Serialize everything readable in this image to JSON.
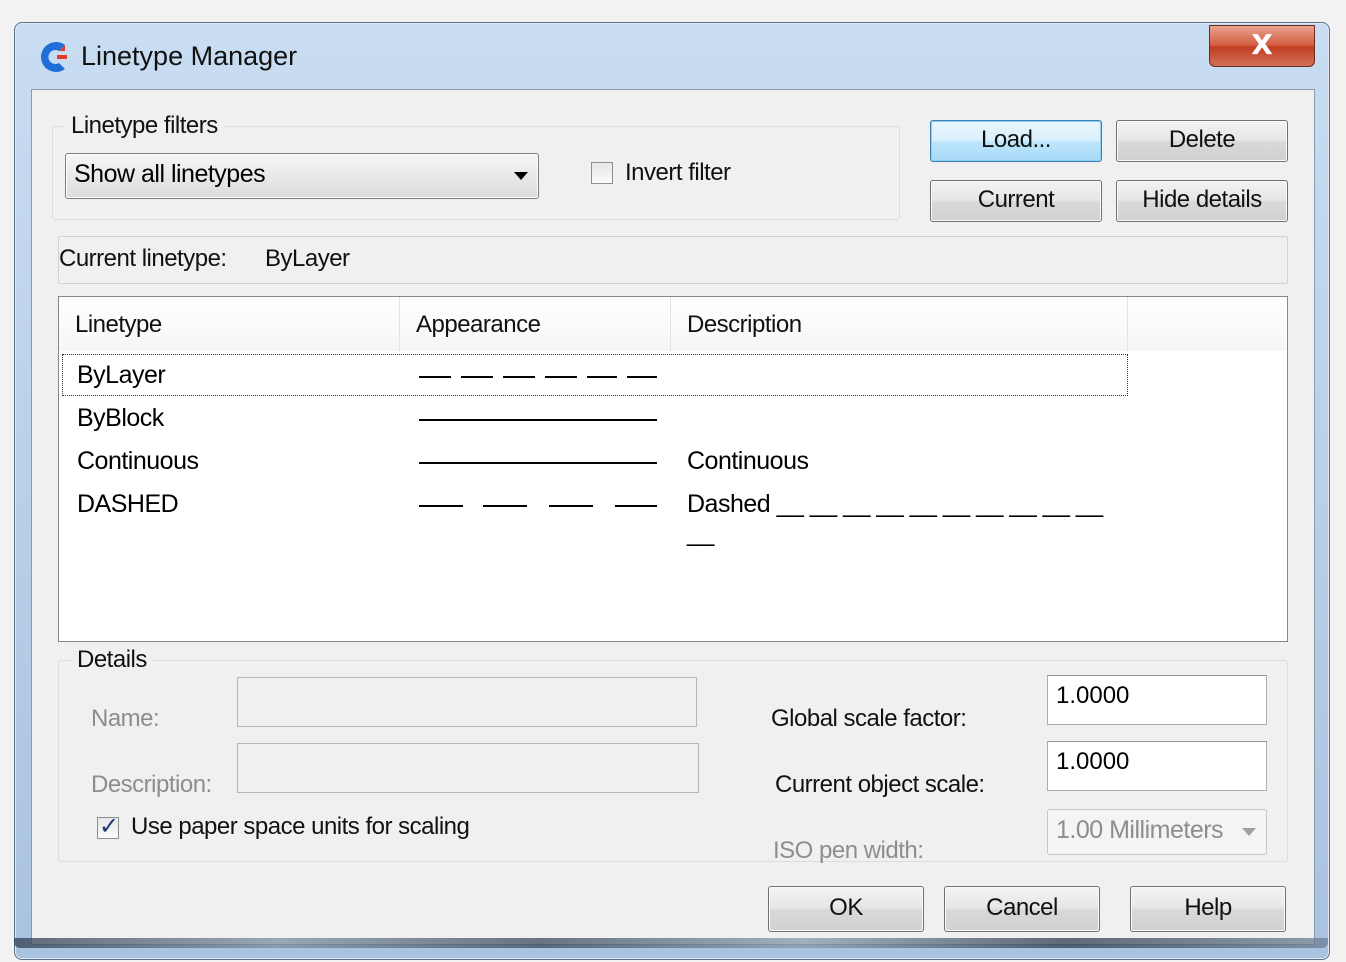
{
  "window": {
    "title": "Linetype Manager",
    "close_label": "X"
  },
  "filters": {
    "caption": "Linetype filters",
    "selected": "Show all linetypes",
    "invert_label": "Invert filter",
    "invert_checked": false
  },
  "buttons": {
    "load": "Load...",
    "delete": "Delete",
    "current": "Current",
    "hide_details": "Hide details"
  },
  "current_linetype": {
    "label": "Current linetype:",
    "value": "ByLayer"
  },
  "list": {
    "columns": [
      "Linetype",
      "Appearance",
      "Description"
    ],
    "rows": [
      {
        "name": "ByLayer",
        "appearance": "dashed-short",
        "description": ""
      },
      {
        "name": "ByBlock",
        "appearance": "solid",
        "description": ""
      },
      {
        "name": "Continuous",
        "appearance": "solid",
        "description": "Continuous"
      },
      {
        "name": "DASHED",
        "appearance": "dashed-long",
        "description": "Dashed __ __ __ __ __ __ __ __ __ __ __"
      }
    ],
    "selected_index": 0
  },
  "details": {
    "caption": "Details",
    "name_label": "Name:",
    "name_value": "",
    "description_label": "Description:",
    "description_value": "",
    "paper_space_label": "Use paper space units for scaling",
    "paper_space_checked": true,
    "global_scale_label": "Global scale factor:",
    "global_scale_value": "1.0000",
    "object_scale_label": "Current object scale:",
    "object_scale_value": "1.0000",
    "iso_pen_label": "ISO pen width:",
    "iso_pen_value": "1.00 Millimeters"
  },
  "footer": {
    "ok": "OK",
    "cancel": "Cancel",
    "help": "Help"
  },
  "colors": {
    "accent": "#3c7fb1",
    "close": "#c23c1f"
  }
}
